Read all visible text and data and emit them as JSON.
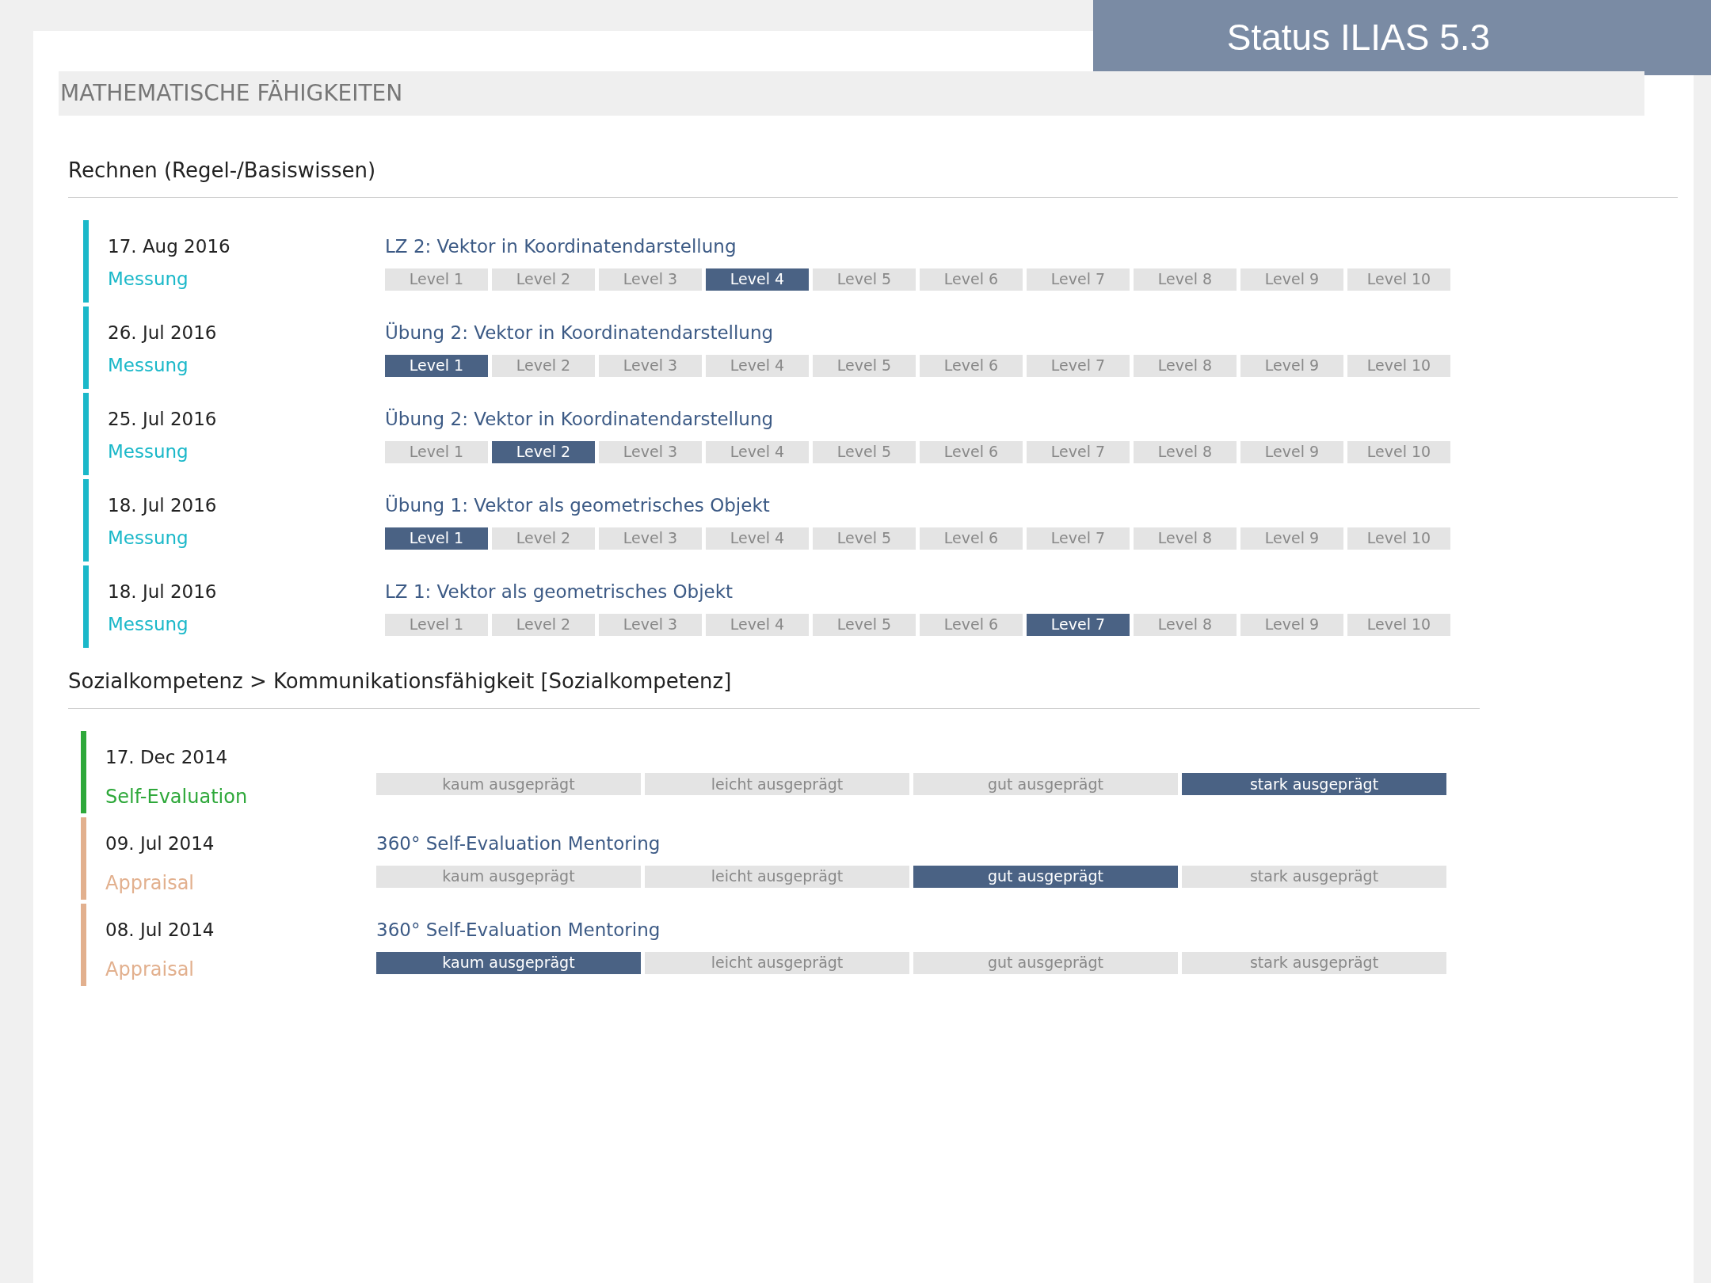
{
  "banner": {
    "title": "Status ILIAS 5.3"
  },
  "header": {
    "title": "MATHEMATISCHE FÄHIGKEITEN"
  },
  "sections": [
    {
      "title": "Rechnen (Regel-/Basiswissen)",
      "entries": [
        {
          "date": "17. Aug 2016",
          "type": "Messung",
          "color": "#1bb8c9",
          "title": "LZ 2: Vektor in Koordinatendarstellung",
          "levels": [
            {
              "label": "Level 1",
              "selected": false
            },
            {
              "label": "Level 2",
              "selected": false
            },
            {
              "label": "Level 3",
              "selected": false
            },
            {
              "label": "Level 4",
              "selected": true
            },
            {
              "label": "Level 5",
              "selected": false
            },
            {
              "label": "Level 6",
              "selected": false
            },
            {
              "label": "Level 7",
              "selected": false
            },
            {
              "label": "Level 8",
              "selected": false
            },
            {
              "label": "Level 9",
              "selected": false
            },
            {
              "label": "Level 10",
              "selected": false
            }
          ]
        },
        {
          "date": "26. Jul 2016",
          "type": "Messung",
          "color": "#1bb8c9",
          "title": "Übung 2: Vektor in Koordinatendarstellung",
          "levels": [
            {
              "label": "Level 1",
              "selected": true
            },
            {
              "label": "Level 2",
              "selected": false
            },
            {
              "label": "Level 3",
              "selected": false
            },
            {
              "label": "Level 4",
              "selected": false
            },
            {
              "label": "Level 5",
              "selected": false
            },
            {
              "label": "Level 6",
              "selected": false
            },
            {
              "label": "Level 7",
              "selected": false
            },
            {
              "label": "Level 8",
              "selected": false
            },
            {
              "label": "Level 9",
              "selected": false
            },
            {
              "label": "Level 10",
              "selected": false
            }
          ]
        },
        {
          "date": "25. Jul 2016",
          "type": "Messung",
          "color": "#1bb8c9",
          "title": "Übung 2: Vektor in Koordinatendarstellung",
          "levels": [
            {
              "label": "Level 1",
              "selected": false
            },
            {
              "label": "Level 2",
              "selected": true
            },
            {
              "label": "Level 3",
              "selected": false
            },
            {
              "label": "Level 4",
              "selected": false
            },
            {
              "label": "Level 5",
              "selected": false
            },
            {
              "label": "Level 6",
              "selected": false
            },
            {
              "label": "Level 7",
              "selected": false
            },
            {
              "label": "Level 8",
              "selected": false
            },
            {
              "label": "Level 9",
              "selected": false
            },
            {
              "label": "Level 10",
              "selected": false
            }
          ]
        },
        {
          "date": "18. Jul 2016",
          "type": "Messung",
          "color": "#1bb8c9",
          "title": "Übung 1: Vektor als geometrisches Objekt",
          "levels": [
            {
              "label": "Level 1",
              "selected": true
            },
            {
              "label": "Level 2",
              "selected": false
            },
            {
              "label": "Level 3",
              "selected": false
            },
            {
              "label": "Level 4",
              "selected": false
            },
            {
              "label": "Level 5",
              "selected": false
            },
            {
              "label": "Level 6",
              "selected": false
            },
            {
              "label": "Level 7",
              "selected": false
            },
            {
              "label": "Level 8",
              "selected": false
            },
            {
              "label": "Level 9",
              "selected": false
            },
            {
              "label": "Level 10",
              "selected": false
            }
          ]
        },
        {
          "date": "18. Jul 2016",
          "type": "Messung",
          "color": "#1bb8c9",
          "title": "LZ 1: Vektor als geometrisches Objekt",
          "levels": [
            {
              "label": "Level 1",
              "selected": false
            },
            {
              "label": "Level 2",
              "selected": false
            },
            {
              "label": "Level 3",
              "selected": false
            },
            {
              "label": "Level 4",
              "selected": false
            },
            {
              "label": "Level 5",
              "selected": false
            },
            {
              "label": "Level 6",
              "selected": false
            },
            {
              "label": "Level 7",
              "selected": true
            },
            {
              "label": "Level 8",
              "selected": false
            },
            {
              "label": "Level 9",
              "selected": false
            },
            {
              "label": "Level 10",
              "selected": false
            }
          ]
        }
      ]
    },
    {
      "title": "Sozialkompetenz > Kommunikationsfähigkeit [Sozialkompetenz]",
      "entries": [
        {
          "date": "17. Dec 2014",
          "type": "Self-Evaluation",
          "color": "#2ea83a",
          "levels": [
            {
              "label": "kaum ausgeprägt",
              "selected": false
            },
            {
              "label": "leicht ausgeprägt",
              "selected": false
            },
            {
              "label": "gut ausgeprägt",
              "selected": false
            },
            {
              "label": "stark ausgeprägt",
              "selected": true
            }
          ]
        },
        {
          "date": "09. Jul 2014",
          "type": "Appraisal",
          "color": "#e2b08e",
          "title": "360° Self-Evaluation Mentoring",
          "levels": [
            {
              "label": "kaum ausgeprägt",
              "selected": false
            },
            {
              "label": "leicht ausgeprägt",
              "selected": false
            },
            {
              "label": "gut ausgeprägt",
              "selected": true
            },
            {
              "label": "stark ausgeprägt",
              "selected": false
            }
          ]
        },
        {
          "date": "08. Jul 2014",
          "type": "Appraisal",
          "color": "#e2b08e",
          "title": "360° Self-Evaluation Mentoring",
          "levels": [
            {
              "label": "kaum ausgeprägt",
              "selected": true
            },
            {
              "label": "leicht ausgeprägt",
              "selected": false
            },
            {
              "label": "gut ausgeprägt",
              "selected": false
            },
            {
              "label": "stark ausgeprägt",
              "selected": false
            }
          ]
        }
      ]
    }
  ]
}
